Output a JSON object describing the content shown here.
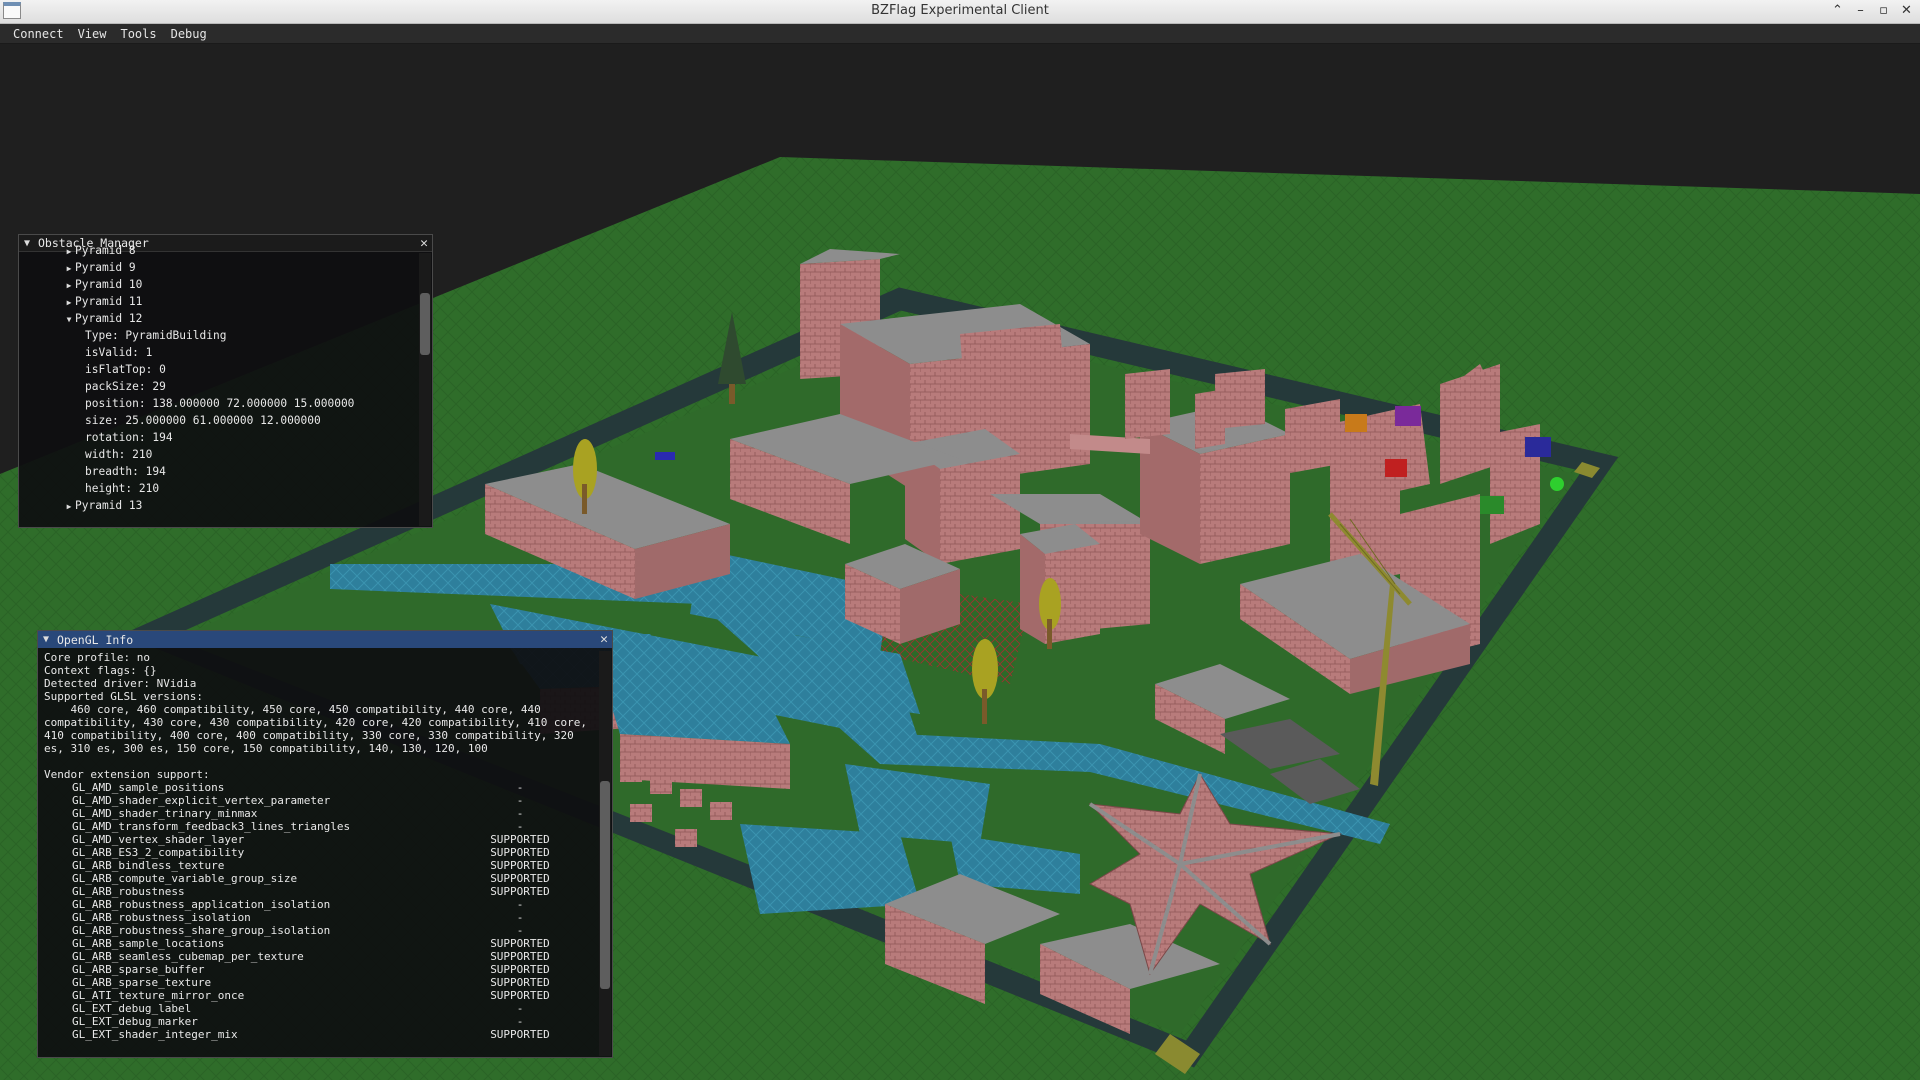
{
  "window": {
    "title": "BZFlag Experimental Client"
  },
  "menu": [
    "Connect",
    "View",
    "Tools",
    "Debug"
  ],
  "obstacle_manager": {
    "title": "Obstacle Manager",
    "rows": [
      {
        "indent": 1,
        "arrow": "collapsed",
        "text": "Pyramid 8"
      },
      {
        "indent": 1,
        "arrow": "collapsed",
        "text": "Pyramid 9"
      },
      {
        "indent": 1,
        "arrow": "collapsed",
        "text": "Pyramid 10"
      },
      {
        "indent": 1,
        "arrow": "collapsed",
        "text": "Pyramid 11"
      },
      {
        "indent": 1,
        "arrow": "expanded",
        "text": "Pyramid 12"
      },
      {
        "indent": 2,
        "arrow": "none",
        "text": "Type: PyramidBuilding"
      },
      {
        "indent": 2,
        "arrow": "none",
        "text": "isValid: 1"
      },
      {
        "indent": 2,
        "arrow": "none",
        "text": "isFlatTop: 0"
      },
      {
        "indent": 2,
        "arrow": "none",
        "text": "packSize: 29"
      },
      {
        "indent": 2,
        "arrow": "none",
        "text": "position: 138.000000 72.000000 15.000000"
      },
      {
        "indent": 2,
        "arrow": "none",
        "text": "size: 25.000000 61.000000 12.000000"
      },
      {
        "indent": 2,
        "arrow": "none",
        "text": "rotation: 194"
      },
      {
        "indent": 2,
        "arrow": "none",
        "text": "width: 210"
      },
      {
        "indent": 2,
        "arrow": "none",
        "text": "breadth: 194"
      },
      {
        "indent": 2,
        "arrow": "none",
        "text": "height: 210"
      },
      {
        "indent": 1,
        "arrow": "collapsed",
        "text": "Pyramid 13"
      }
    ]
  },
  "opengl_info": {
    "title": "OpenGL Info",
    "core_profile": "Core profile: no",
    "context_flags": "Context flags: {}",
    "driver": "Detected driver: NVidia",
    "glsl_label": "Supported GLSL versions:",
    "glsl_versions": "    460 core, 460 compatibility, 450 core, 450 compatibility, 440 core, 440 compatibility, 430 core, 430 compatibility, 420 core, 420 compatibility, 410 core, 410 compatibility, 400 core, 400 compatibility, 330 core, 330 compatibility, 320 es, 310 es, 300 es, 150 core, 150 compatibility, 140, 130, 120, 100",
    "vendor_label": "Vendor extension support:",
    "extensions": [
      {
        "name": "GL_AMD_sample_positions",
        "status": "-"
      },
      {
        "name": "GL_AMD_shader_explicit_vertex_parameter",
        "status": "-"
      },
      {
        "name": "GL_AMD_shader_trinary_minmax",
        "status": "-"
      },
      {
        "name": "GL_AMD_transform_feedback3_lines_triangles",
        "status": "-"
      },
      {
        "name": "GL_AMD_vertex_shader_layer",
        "status": "SUPPORTED"
      },
      {
        "name": "GL_ARB_ES3_2_compatibility",
        "status": "SUPPORTED"
      },
      {
        "name": "GL_ARB_bindless_texture",
        "status": "SUPPORTED"
      },
      {
        "name": "GL_ARB_compute_variable_group_size",
        "status": "SUPPORTED"
      },
      {
        "name": "GL_ARB_robustness",
        "status": "SUPPORTED"
      },
      {
        "name": "GL_ARB_robustness_application_isolation",
        "status": "-"
      },
      {
        "name": "GL_ARB_robustness_isolation",
        "status": "-"
      },
      {
        "name": "GL_ARB_robustness_share_group_isolation",
        "status": "-"
      },
      {
        "name": "GL_ARB_sample_locations",
        "status": "SUPPORTED"
      },
      {
        "name": "GL_ARB_seamless_cubemap_per_texture",
        "status": "SUPPORTED"
      },
      {
        "name": "GL_ARB_sparse_buffer",
        "status": "SUPPORTED"
      },
      {
        "name": "GL_ARB_sparse_texture",
        "status": "SUPPORTED"
      },
      {
        "name": "GL_ATI_texture_mirror_once",
        "status": "SUPPORTED"
      },
      {
        "name": "GL_EXT_debug_label",
        "status": "-"
      },
      {
        "name": "GL_EXT_debug_marker",
        "status": "-"
      },
      {
        "name": "GL_EXT_shader_integer_mix",
        "status": "SUPPORTED"
      }
    ]
  },
  "colors": {
    "ground": "#2f6e2a",
    "road": "#263c3c",
    "brick": "#b67a7a",
    "roof": "#8a8a8a",
    "water": "#2d7c98",
    "panel_title_active": "#29487a"
  }
}
